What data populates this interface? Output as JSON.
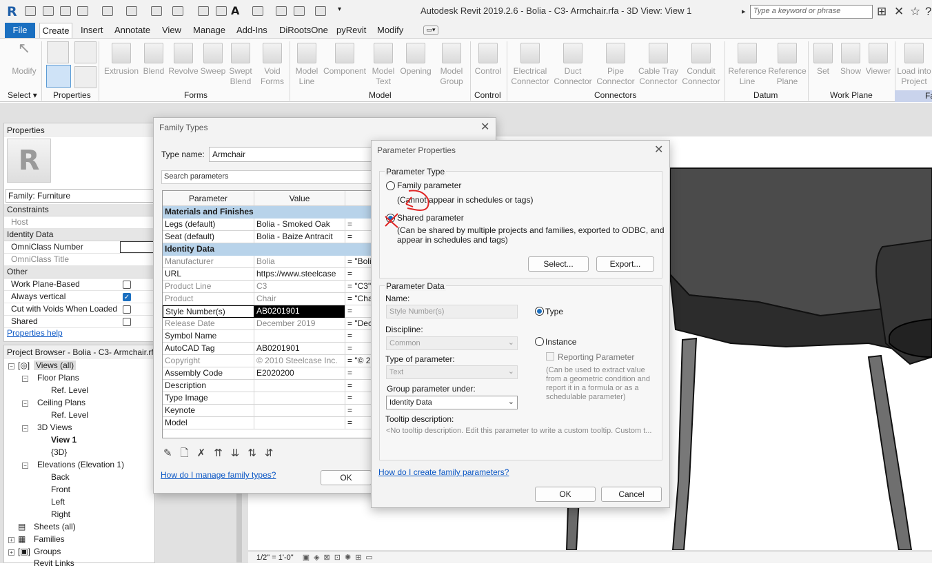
{
  "app": {
    "title": "Autodesk Revit 2019.2.6 - Bolia - C3- Armchair.rfa - 3D View: View 1",
    "logo": "R",
    "search_placeholder": "Type a keyword or phrase"
  },
  "menu_tabs": [
    "File",
    "Create",
    "Insert",
    "Annotate",
    "View",
    "Manage",
    "Add-Ins",
    "DiRootsOne",
    "pyRevit",
    "Modify"
  ],
  "ribbon": {
    "modify": "Modify",
    "select": "Select",
    "properties": "Properties",
    "forms_tools": [
      "Extrusion",
      "Blend",
      "Revolve",
      "Sweep",
      "Swept\nBlend",
      "Void\nForms"
    ],
    "model_tools": [
      "Model\nLine",
      "Component",
      "Model\nText",
      "Opening",
      "Model\nGroup"
    ],
    "control_tool": "Control",
    "connector_tools": [
      "Electrical\nConnector",
      "Duct\nConnector",
      "Pipe\nConnector",
      "Cable Tray\nConnector",
      "Conduit\nConnector"
    ],
    "datum_tools": [
      "Reference\nLine",
      "Reference\nPlane"
    ],
    "workplane_tools": [
      "Set",
      "Show",
      "Viewer"
    ],
    "load_tool": "Load into\nProject",
    "panels": [
      "Forms",
      "Model",
      "Control",
      "Connectors",
      "Datum",
      "Work Plane",
      "Fa"
    ]
  },
  "properties": {
    "title": "Properties",
    "family": "Family: Furniture",
    "constraints": "Constraints",
    "host": "Host",
    "identity_data": "Identity Data",
    "omniclass_number": "OmniClass Number",
    "omniclass_title": "OmniClass Title",
    "other": "Other",
    "rows": [
      {
        "label": "Work Plane-Based",
        "checked": false
      },
      {
        "label": "Always vertical",
        "checked": true
      },
      {
        "label": "Cut with Voids When Loaded",
        "checked": false
      },
      {
        "label": "Shared",
        "checked": false
      }
    ],
    "help": "Properties help"
  },
  "project_browser": {
    "title": "Project Browser - Bolia - C3- Armchair.rfa",
    "items": [
      "Views (all)",
      "Floor Plans",
      "Ref. Level",
      "Ceiling Plans",
      "Ref. Level",
      "3D Views",
      "View 1",
      "{3D}",
      "Elevations (Elevation 1)",
      "Back",
      "Front",
      "Left",
      "Right",
      "Sheets (all)",
      "Families",
      "Groups",
      "Revit Links"
    ]
  },
  "view_status": "1/2\" = 1'-0\"",
  "family_types": {
    "title": "Family Types",
    "type_name_label": "Type name:",
    "type_name": "Armchair",
    "search_placeholder": "Search parameters",
    "col_parameter": "Parameter",
    "col_value": "Value",
    "cat_materials": "Materials and Finishes",
    "cat_identity": "Identity Data",
    "rows": [
      {
        "param": "Legs (default)",
        "value": "Bolia - Smoked Oak",
        "formula": "=",
        "grey": false
      },
      {
        "param": "Seat (default)",
        "value": "Bolia - Baize Antracit",
        "formula": "=",
        "grey": false
      },
      {
        "param": "Manufacturer",
        "value": "Bolia",
        "formula": "= \"Bolia",
        "grey": true
      },
      {
        "param": "URL",
        "value": "https://www.steelcase",
        "formula": "=",
        "grey": false
      },
      {
        "param": "Product Line",
        "value": "C3",
        "formula": "= \"C3\"",
        "grey": true
      },
      {
        "param": "Product",
        "value": "Chair",
        "formula": "= \"Cha",
        "grey": true
      },
      {
        "param": "Style Number(s)",
        "value": "AB0201901",
        "formula": "=",
        "grey": false,
        "selected": true
      },
      {
        "param": "Release Date",
        "value": "December 2019",
        "formula": "= \"Dece",
        "grey": true
      },
      {
        "param": "Symbol Name",
        "value": "",
        "formula": "=",
        "grey": false
      },
      {
        "param": "AutoCAD Tag",
        "value": "AB0201901",
        "formula": "=",
        "grey": false
      },
      {
        "param": "Copyright",
        "value": "© 2010 Steelcase Inc.",
        "formula": "= \"© 2",
        "grey": true
      },
      {
        "param": "Assembly Code",
        "value": "E2020200",
        "formula": "=",
        "grey": false
      },
      {
        "param": "Description",
        "value": "",
        "formula": "=",
        "grey": false
      },
      {
        "param": "Type Image",
        "value": "",
        "formula": "=",
        "grey": false
      },
      {
        "param": "Keynote",
        "value": "",
        "formula": "=",
        "grey": false
      },
      {
        "param": "Model",
        "value": "",
        "formula": "=",
        "grey": false
      }
    ],
    "help_link": "How do I manage family types?",
    "ok": "OK"
  },
  "param_props": {
    "title": "Parameter Properties",
    "type_group": "Parameter Type",
    "family_param": "Family parameter",
    "family_note": "(Cannot appear in schedules or tags)",
    "shared_param": "Shared parameter",
    "shared_note": "(Can be shared by multiple projects and families, exported to ODBC, and\nappear in schedules and tags)",
    "select_btn": "Select...",
    "export_btn": "Export...",
    "data_group": "Parameter Data",
    "name_label": "Name:",
    "name_value": "Style Number(s)",
    "type_radio": "Type",
    "instance_radio": "Instance",
    "discipline_label": "Discipline:",
    "discipline_value": "Common",
    "reporting": "Reporting Parameter",
    "reporting_note": "(Can be used to extract value\nfrom a geometric condition and\nreport it in a formula or as a\nschedulable parameter)",
    "type_of_param_label": "Type of parameter:",
    "type_of_param_value": "Text",
    "group_under_label": "Group parameter under:",
    "group_under_value": "Identity Data",
    "tooltip_label": "Tooltip description:",
    "tooltip_value": "<No tooltip description. Edit this parameter to write a custom tooltip. Custom t...",
    "help_link": "How do I create family parameters?",
    "ok": "OK",
    "cancel": "Cancel"
  }
}
